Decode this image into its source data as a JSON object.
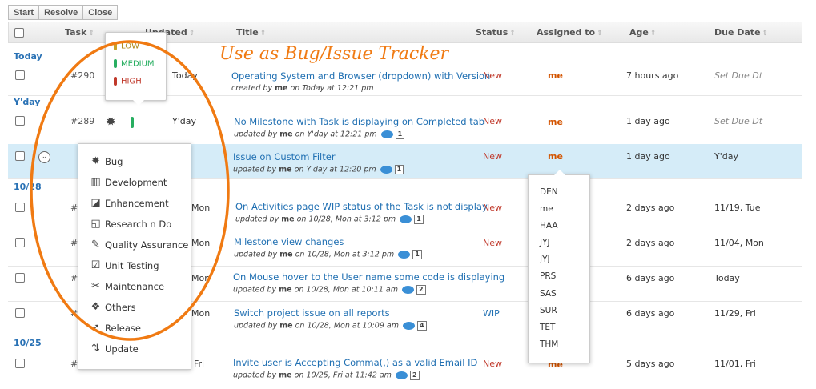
{
  "toolbar": {
    "start": "Start",
    "resolve": "Resolve",
    "close": "Close"
  },
  "headers": {
    "task": "Task",
    "updated": "Updated",
    "title": "Title",
    "status": "Status",
    "assigned": "Assigned to",
    "age": "Age",
    "due": "Due Date",
    "sort_glyph": "⇕"
  },
  "groups": {
    "today": "Today",
    "yday": "Y'day",
    "g1028": "10/28",
    "g1025": "10/25"
  },
  "rows": [
    {
      "task": "#290",
      "updated": "Today",
      "title": "Operating System and Browser (dropdown) with Version",
      "sub_pre": "created by",
      "sub_user": "me",
      "sub_post": "on Today at 12:21 pm",
      "count": "",
      "status": "New",
      "assigned": "me",
      "age": "7 hours ago",
      "due": "Set Due Dt"
    },
    {
      "task": "#289",
      "updated": "Y'day",
      "title": "No Milestone with Task is displaying on Completed tab",
      "sub_pre": "updated by",
      "sub_user": "me",
      "sub_post": "on Y'day at 12:21 pm",
      "count": "1",
      "status": "New",
      "assigned": "me",
      "age": "1 day ago",
      "due": "Set Due Dt"
    },
    {
      "task": "",
      "updated": "y",
      "title": "Issue on Custom Filter",
      "sub_pre": "updated by",
      "sub_user": "me",
      "sub_post": "on Y'day at 12:20 pm",
      "count": "1",
      "status": "New",
      "assigned": "me",
      "age": "1 day ago",
      "due": "Y'day"
    },
    {
      "task": "#",
      "updated": "Mon",
      "title": "On Activities page WIP status of the Task is not display",
      "sub_pre": "updated by",
      "sub_user": "me",
      "sub_post": "on 10/28, Mon at 3:12 pm",
      "count": "1",
      "status": "New",
      "assigned": "",
      "age": "2 days ago",
      "due": "11/19, Tue"
    },
    {
      "task": "#",
      "updated": "Mon",
      "title": "Milestone view changes",
      "sub_pre": "updated by",
      "sub_user": "me",
      "sub_post": "on 10/28, Mon at 3:12 pm",
      "count": "1",
      "status": "New",
      "assigned": "",
      "age": "2 days ago",
      "due": "11/04, Mon"
    },
    {
      "task": "#",
      "updated": "Mon",
      "title": "On Mouse hover to the User name some code is displaying",
      "sub_pre": "updated by",
      "sub_user": "me",
      "sub_post": "on 10/28, Mon at 10:11 am",
      "count": "2",
      "status": "",
      "assigned": "",
      "age": "6 days ago",
      "due": "Today"
    },
    {
      "task": "#",
      "updated": "Mon",
      "title": "Switch project issue on all reports",
      "sub_pre": "updated by",
      "sub_user": "me",
      "sub_post": "on 10/28, Mon at 10:09 am",
      "count": "4",
      "status": "WIP",
      "assigned": "",
      "age": "6 days ago",
      "due": "11/29, Fri"
    },
    {
      "task": "#",
      "updated": "Fri",
      "title": "Invite user is Accepting Comma(,) as a valid Email ID",
      "sub_pre": "updated by",
      "sub_user": "me",
      "sub_post": "on 10/25, Fri at 11:42 am",
      "count": "2",
      "status": "New",
      "assigned": "me",
      "age": "5 days ago",
      "due": "11/01, Fri"
    }
  ],
  "priority": {
    "low": "LOW",
    "medium": "MEDIUM",
    "high": "HIGH",
    "colors": {
      "low": "#c9a227",
      "medium": "#27ae60",
      "high": "#c0392b"
    }
  },
  "types": [
    {
      "label": "Bug",
      "icon": "bug-icon",
      "glyph": "✹"
    },
    {
      "label": "Development",
      "icon": "bar-chart-icon",
      "glyph": "▥"
    },
    {
      "label": "Enhancement",
      "icon": "enhancement-icon",
      "glyph": "◪"
    },
    {
      "label": "Research n Do",
      "icon": "research-icon",
      "glyph": "◱"
    },
    {
      "label": "Quality Assurance",
      "icon": "qa-icon",
      "glyph": "✎"
    },
    {
      "label": "Unit Testing",
      "icon": "unit-test-icon",
      "glyph": "☑"
    },
    {
      "label": "Maintenance",
      "icon": "tools-icon",
      "glyph": "✂"
    },
    {
      "label": "Others",
      "icon": "others-icon",
      "glyph": "❖"
    },
    {
      "label": "Release",
      "icon": "release-icon",
      "glyph": "➚"
    },
    {
      "label": "Update",
      "icon": "update-icon",
      "glyph": "⇅"
    }
  ],
  "assignees": [
    "DEN",
    "me",
    "HAA",
    "JYJ",
    "JYJ",
    "PRS",
    "SAS",
    "SUR",
    "TET",
    "THM"
  ],
  "annotation": "Use as Bug/Issue Tracker",
  "toggle_glyph": "⌄",
  "bug_glyph": "✹",
  "colors": {
    "accent": "#f07a12",
    "link": "#1f6fb2",
    "highlight_row": "#d5ecf8"
  }
}
